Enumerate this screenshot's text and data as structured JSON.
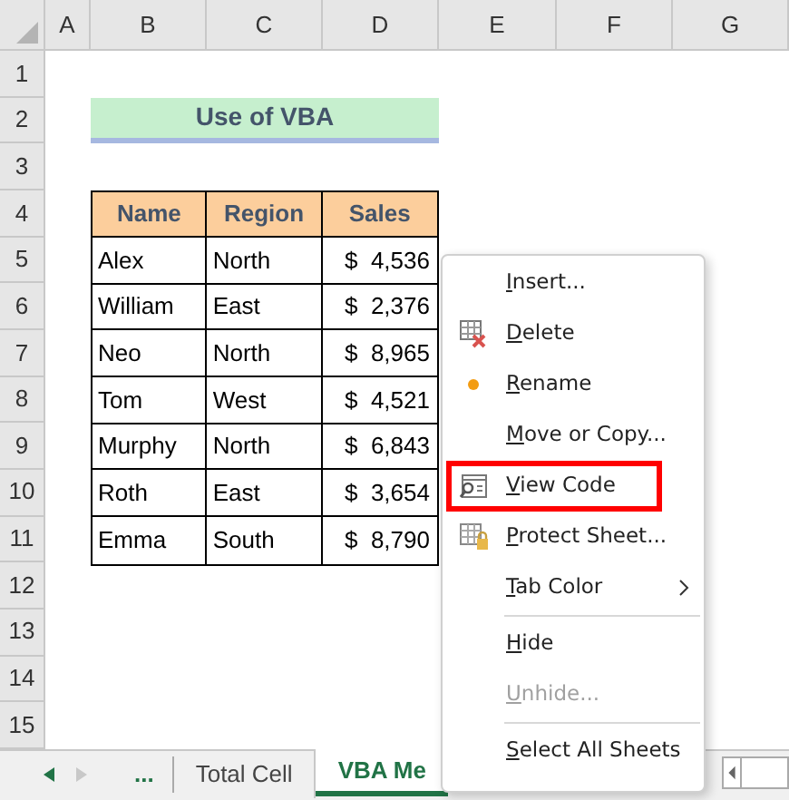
{
  "columns": [
    "A",
    "B",
    "C",
    "D",
    "E",
    "F",
    "G"
  ],
  "rows": [
    "1",
    "2",
    "3",
    "4",
    "5",
    "6",
    "7",
    "8",
    "9",
    "10",
    "11",
    "12",
    "13",
    "14",
    "15"
  ],
  "title": "Use of VBA",
  "table": {
    "columns": [
      "Name",
      "Region",
      "Sales"
    ],
    "rows": [
      [
        "Alex",
        "North",
        "$  4,536"
      ],
      [
        "William",
        "East",
        "$  2,376"
      ],
      [
        "Neo",
        "North",
        "$  8,965"
      ],
      [
        "Tom",
        "West",
        "$  4,521"
      ],
      [
        "Murphy",
        "North",
        "$  6,843"
      ],
      [
        "Roth",
        "East",
        "$  3,654"
      ],
      [
        "Emma",
        "South",
        "$  8,790"
      ]
    ]
  },
  "sheet_tabs": {
    "more": "...",
    "tabs": [
      {
        "label": "Total Cell",
        "selected": false
      },
      {
        "label": "VBA Me",
        "selected": true
      }
    ]
  },
  "context_menu": [
    {
      "label": "Insert...",
      "kind": "plain",
      "disabled": false,
      "highlighted": false,
      "submenu": false
    },
    {
      "label": "Delete",
      "kind": "delete",
      "disabled": false,
      "highlighted": false,
      "submenu": false
    },
    {
      "label": "Rename",
      "kind": "rename",
      "disabled": false,
      "highlighted": false,
      "submenu": false
    },
    {
      "label": "Move or Copy...",
      "kind": "plain",
      "disabled": false,
      "highlighted": false,
      "submenu": false
    },
    {
      "label": "View Code",
      "kind": "code",
      "disabled": false,
      "highlighted": true,
      "submenu": false
    },
    {
      "label": "Protect Sheet...",
      "kind": "protect",
      "disabled": false,
      "highlighted": false,
      "submenu": false
    },
    {
      "label": "Tab Color",
      "kind": "plain",
      "disabled": false,
      "highlighted": false,
      "submenu": true,
      "separator_after": true
    },
    {
      "label": "Hide",
      "kind": "plain",
      "disabled": false,
      "highlighted": false,
      "submenu": false
    },
    {
      "label": "Unhide...",
      "kind": "plain",
      "disabled": true,
      "highlighted": false,
      "submenu": false,
      "separator_after": true
    },
    {
      "label": "Select All Sheets",
      "kind": "plain",
      "disabled": false,
      "highlighted": false,
      "submenu": false
    }
  ]
}
